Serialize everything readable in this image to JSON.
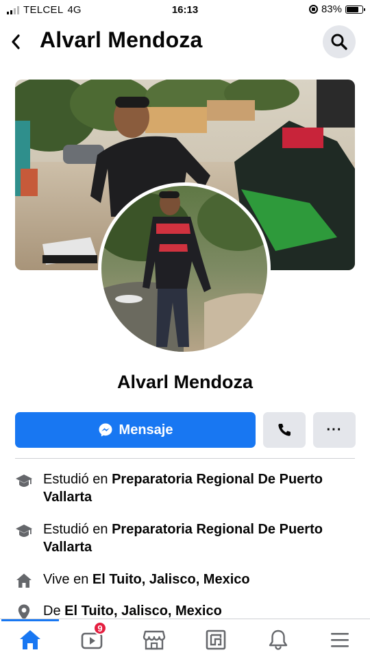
{
  "status_bar": {
    "carrier": "TELCEL",
    "network": "4G",
    "time": "16:13",
    "battery_percent": "83%",
    "battery_level": 0.83,
    "signal_bars": 2
  },
  "header": {
    "title": "Alvarl Mendoza",
    "back_icon": "chevron-left-icon",
    "search_icon": "search-icon"
  },
  "profile": {
    "name": "Alvarl Mendoza",
    "cover_photo_icon": "cover-photo",
    "avatar_icon": "profile-picture"
  },
  "actions": {
    "message_label": "Mensaje",
    "message_icon": "messenger-icon",
    "call_icon": "phone-icon",
    "more_label": "···"
  },
  "info": [
    {
      "icon": "graduation-cap-icon",
      "prefix": "Estudió en",
      "value": "Preparatoria Regional De Puerto Vallarta"
    },
    {
      "icon": "graduation-cap-icon",
      "prefix": "Estudió en",
      "value": "Preparatoria Regional De Puerto Vallarta"
    },
    {
      "icon": "home-icon",
      "prefix": "Vive en",
      "value": "El Tuito, Jalisco, Mexico"
    },
    {
      "icon": "location-pin-icon",
      "prefix": "De",
      "value": "El Tuito, Jalisco, Mexico"
    }
  ],
  "bottom_nav": {
    "items": [
      {
        "name": "home",
        "icon": "home-icon",
        "active": true
      },
      {
        "name": "watch",
        "icon": "video-icon",
        "badge": "9"
      },
      {
        "name": "marketplace",
        "icon": "marketplace-icon"
      },
      {
        "name": "news",
        "icon": "news-icon"
      },
      {
        "name": "notifications",
        "icon": "bell-icon"
      },
      {
        "name": "menu",
        "icon": "menu-icon"
      }
    ]
  },
  "colors": {
    "accent": "#1877f2",
    "button_gray": "#e4e6eb",
    "text": "#050505",
    "badge": "#e41e3f"
  }
}
